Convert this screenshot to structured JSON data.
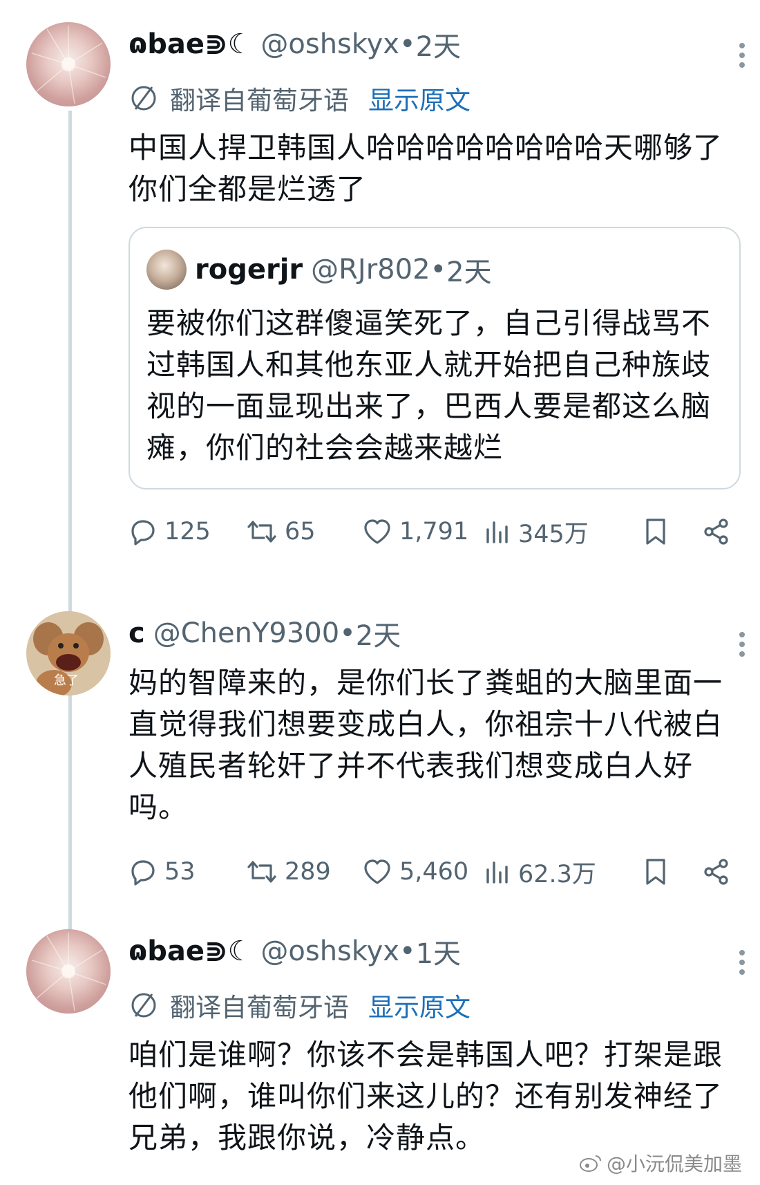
{
  "tweets": [
    {
      "name": "ɷbae⋑☾",
      "handle": "@oshskyx",
      "sep": " • ",
      "time": "2天",
      "translate_label": "翻译自葡萄牙语",
      "translate_link": "显示原文",
      "text": "中国人捍卫韩国人哈哈哈哈哈哈哈哈天哪够了你们全都是烂透了",
      "quote": {
        "name": "rogerjr",
        "handle": "@RJr802",
        "sep": " • ",
        "time": "2天",
        "text": "要被你们这群傻逼笑死了，自己引得战骂不过韩国人和其他东亚人就开始把自己种族歧视的一面显现出来了，巴西人要是都这么脑瘫，你们的社会会越来越烂"
      },
      "stats": {
        "replies": "125",
        "retweets": "65",
        "likes": "1,791",
        "views": "345万"
      }
    },
    {
      "name": "c",
      "handle": "@ChenY9300",
      "sep": " • ",
      "time": "2天",
      "avatar_text": "急了",
      "text": "妈的智障来的，是你们长了粪蛆的大脑里面一直觉得我们想要变成白人，你祖宗十八代被白人殖民者轮奸了并不代表我们想变成白人好吗。",
      "stats": {
        "replies": "53",
        "retweets": "289",
        "likes": "5,460",
        "views": "62.3万"
      }
    },
    {
      "name": "ɷbae⋑☾",
      "handle": "@oshskyx",
      "sep": " • ",
      "time": "1天",
      "translate_label": "翻译自葡萄牙语",
      "translate_link": "显示原文",
      "text": "咱们是谁啊？你该不会是韩国人吧？打架是跟他们啊，谁叫你们来这儿的？还有别发神经了兄弟，我跟你说，冷静点。"
    }
  ],
  "watermark": "@小沅侃美加墨",
  "colors": {
    "link": "#1d6fb8",
    "secondary": "#536471",
    "thread_line": "#cfd9de"
  }
}
